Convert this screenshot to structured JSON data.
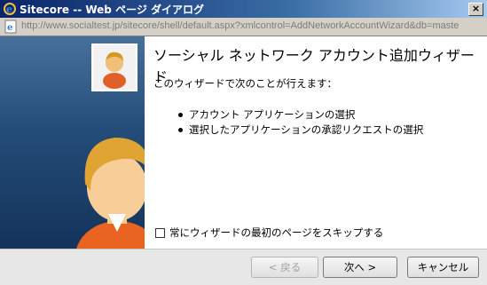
{
  "window": {
    "title": "Sitecore -- Web ページ ダイアログ",
    "close_glyph": "×"
  },
  "address_bar": {
    "url": "http://www.socialtest.jp/sitecore/shell/default.aspx?xmlcontrol=AddNetworkAccountWizard&db=maste"
  },
  "wizard": {
    "title": "ソーシャル ネットワーク アカウント追加ウィザード",
    "intro": "このウィザードで次のことが行えます：",
    "bullets": [
      "アカウント アプリケーションの選択",
      "選択したアプリケーションの承認リクエストの選択"
    ],
    "skip_checkbox_label": "常にウィザードの最初のページをスキップする"
  },
  "buttons": {
    "back": "< 戻る",
    "next": "次へ >",
    "cancel": "キャンセル"
  },
  "colors": {
    "panel_blue": "#244c78",
    "title_bar": "#0a246a"
  }
}
